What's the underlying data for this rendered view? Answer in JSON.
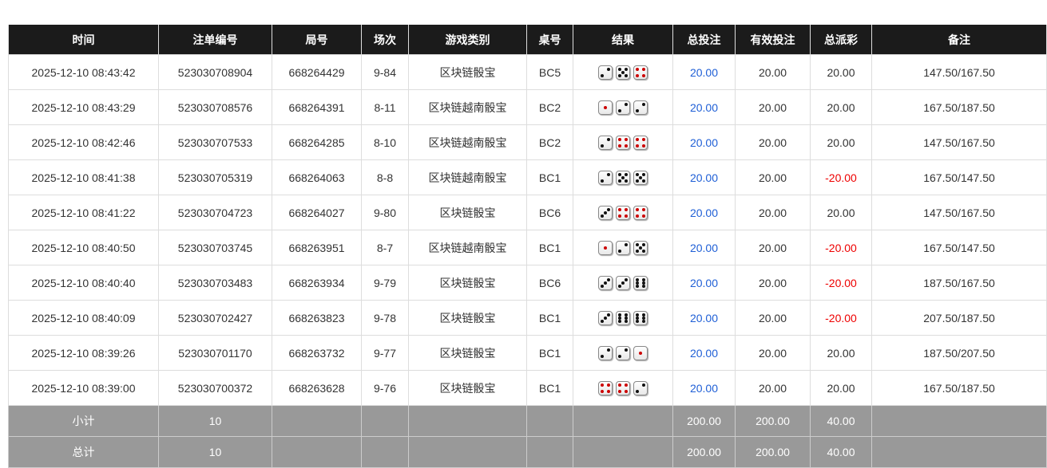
{
  "headers": [
    "时间",
    "注单编号",
    "局号",
    "场次",
    "游戏类别",
    "桌号",
    "结果",
    "总投注",
    "有效投注",
    "总派彩",
    "备注"
  ],
  "colors": {
    "header_bg": "#1b1b1b",
    "bet_link": "#1f5fd6",
    "negative": "#e00000",
    "footer_bg": "#999999"
  },
  "rows": [
    {
      "time": "2025-12-10 08:43:42",
      "bet_id": "523030708904",
      "round": "668264429",
      "session": "9-84",
      "game": "区块链骰宝",
      "table": "BC5",
      "dice": [
        2,
        5,
        4
      ],
      "total": "20.00",
      "valid": "20.00",
      "payout": "20.00",
      "note": "147.50/167.50"
    },
    {
      "time": "2025-12-10 08:43:29",
      "bet_id": "523030708576",
      "round": "668264391",
      "session": "8-11",
      "game": "区块链越南骰宝",
      "table": "BC2",
      "dice": [
        1,
        2,
        2
      ],
      "total": "20.00",
      "valid": "20.00",
      "payout": "20.00",
      "note": "167.50/187.50"
    },
    {
      "time": "2025-12-10 08:42:46",
      "bet_id": "523030707533",
      "round": "668264285",
      "session": "8-10",
      "game": "区块链越南骰宝",
      "table": "BC2",
      "dice": [
        2,
        4,
        4
      ],
      "total": "20.00",
      "valid": "20.00",
      "payout": "20.00",
      "note": "147.50/167.50"
    },
    {
      "time": "2025-12-10 08:41:38",
      "bet_id": "523030705319",
      "round": "668264063",
      "session": "8-8",
      "game": "区块链越南骰宝",
      "table": "BC1",
      "dice": [
        2,
        5,
        5
      ],
      "total": "20.00",
      "valid": "20.00",
      "payout": "-20.00",
      "note": "167.50/147.50"
    },
    {
      "time": "2025-12-10 08:41:22",
      "bet_id": "523030704723",
      "round": "668264027",
      "session": "9-80",
      "game": "区块链骰宝",
      "table": "BC6",
      "dice": [
        3,
        4,
        4
      ],
      "total": "20.00",
      "valid": "20.00",
      "payout": "20.00",
      "note": "147.50/167.50"
    },
    {
      "time": "2025-12-10 08:40:50",
      "bet_id": "523030703745",
      "round": "668263951",
      "session": "8-7",
      "game": "区块链越南骰宝",
      "table": "BC1",
      "dice": [
        1,
        2,
        5
      ],
      "total": "20.00",
      "valid": "20.00",
      "payout": "-20.00",
      "note": "167.50/147.50"
    },
    {
      "time": "2025-12-10 08:40:40",
      "bet_id": "523030703483",
      "round": "668263934",
      "session": "9-79",
      "game": "区块链骰宝",
      "table": "BC6",
      "dice": [
        3,
        3,
        6
      ],
      "total": "20.00",
      "valid": "20.00",
      "payout": "-20.00",
      "note": "187.50/167.50"
    },
    {
      "time": "2025-12-10 08:40:09",
      "bet_id": "523030702427",
      "round": "668263823",
      "session": "9-78",
      "game": "区块链骰宝",
      "table": "BC1",
      "dice": [
        3,
        6,
        6
      ],
      "total": "20.00",
      "valid": "20.00",
      "payout": "-20.00",
      "note": "207.50/187.50"
    },
    {
      "time": "2025-12-10 08:39:26",
      "bet_id": "523030701170",
      "round": "668263732",
      "session": "9-77",
      "game": "区块链骰宝",
      "table": "BC1",
      "dice": [
        2,
        2,
        1
      ],
      "total": "20.00",
      "valid": "20.00",
      "payout": "20.00",
      "note": "187.50/207.50"
    },
    {
      "time": "2025-12-10 08:39:00",
      "bet_id": "523030700372",
      "round": "668263628",
      "session": "9-76",
      "game": "区块链骰宝",
      "table": "BC1",
      "dice": [
        4,
        4,
        2
      ],
      "total": "20.00",
      "valid": "20.00",
      "payout": "20.00",
      "note": "167.50/187.50"
    }
  ],
  "footer": [
    {
      "label": "小计",
      "count": "10",
      "total": "200.00",
      "valid": "200.00",
      "payout": "40.00"
    },
    {
      "label": "总计",
      "count": "10",
      "total": "200.00",
      "valid": "200.00",
      "payout": "40.00"
    }
  ]
}
